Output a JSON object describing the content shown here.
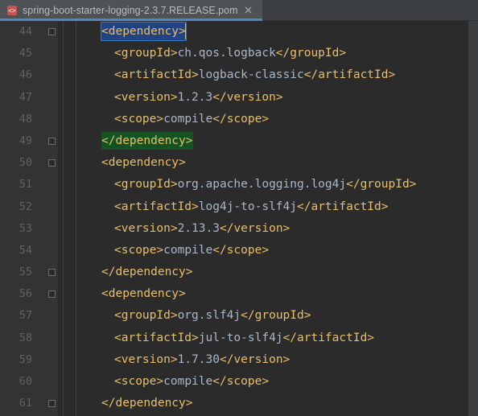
{
  "tab": {
    "filename": "spring-boot-starter-logging-2.3.7.RELEASE.pom"
  },
  "gutter": {
    "start": 44,
    "end": 61
  },
  "colors": {
    "tag": "#e8bf6a",
    "text": "#a9b7c6",
    "tab_underline": "#4a88c7",
    "selection_open": "#214283",
    "selection_close": "#155221"
  },
  "chart_data": {
    "type": "table",
    "title": "Maven dependencies",
    "series": [
      {
        "groupId": "ch.qos.logback",
        "artifactId": "logback-classic",
        "version": "1.2.3",
        "scope": "compile"
      },
      {
        "groupId": "org.apache.logging.log4j",
        "artifactId": "log4j-to-slf4j",
        "version": "2.13.3",
        "scope": "compile"
      },
      {
        "groupId": "org.slf4j",
        "artifactId": "jul-to-slf4j",
        "version": "1.7.30",
        "scope": "compile"
      }
    ]
  },
  "tags": {
    "dependency": "dependency",
    "groupId": "groupId",
    "artifactId": "artifactId",
    "version": "version",
    "scope": "scope"
  },
  "code_lines": [
    {
      "n": 44,
      "indent": 1,
      "kind": "open-hl",
      "tag": "dependency"
    },
    {
      "n": 45,
      "indent": 2,
      "kind": "leaf",
      "tag": "groupId",
      "val": "ch.qos.logback"
    },
    {
      "n": 46,
      "indent": 2,
      "kind": "leaf",
      "tag": "artifactId",
      "val": "logback-classic"
    },
    {
      "n": 47,
      "indent": 2,
      "kind": "leaf",
      "tag": "version",
      "val": "1.2.3"
    },
    {
      "n": 48,
      "indent": 2,
      "kind": "leaf",
      "tag": "scope",
      "val": "compile"
    },
    {
      "n": 49,
      "indent": 1,
      "kind": "close-hl",
      "tag": "dependency"
    },
    {
      "n": 50,
      "indent": 1,
      "kind": "open",
      "tag": "dependency"
    },
    {
      "n": 51,
      "indent": 2,
      "kind": "leaf",
      "tag": "groupId",
      "val": "org.apache.logging.log4j"
    },
    {
      "n": 52,
      "indent": 2,
      "kind": "leaf",
      "tag": "artifactId",
      "val": "log4j-to-slf4j"
    },
    {
      "n": 53,
      "indent": 2,
      "kind": "leaf",
      "tag": "version",
      "val": "2.13.3"
    },
    {
      "n": 54,
      "indent": 2,
      "kind": "leaf",
      "tag": "scope",
      "val": "compile"
    },
    {
      "n": 55,
      "indent": 1,
      "kind": "close",
      "tag": "dependency"
    },
    {
      "n": 56,
      "indent": 1,
      "kind": "open",
      "tag": "dependency"
    },
    {
      "n": 57,
      "indent": 2,
      "kind": "leaf",
      "tag": "groupId",
      "val": "org.slf4j"
    },
    {
      "n": 58,
      "indent": 2,
      "kind": "leaf",
      "tag": "artifactId",
      "val": "jul-to-slf4j"
    },
    {
      "n": 59,
      "indent": 2,
      "kind": "leaf",
      "tag": "version",
      "val": "1.7.30"
    },
    {
      "n": 60,
      "indent": 2,
      "kind": "leaf",
      "tag": "scope",
      "val": "compile"
    },
    {
      "n": 61,
      "indent": 1,
      "kind": "close",
      "tag": "dependency"
    }
  ]
}
